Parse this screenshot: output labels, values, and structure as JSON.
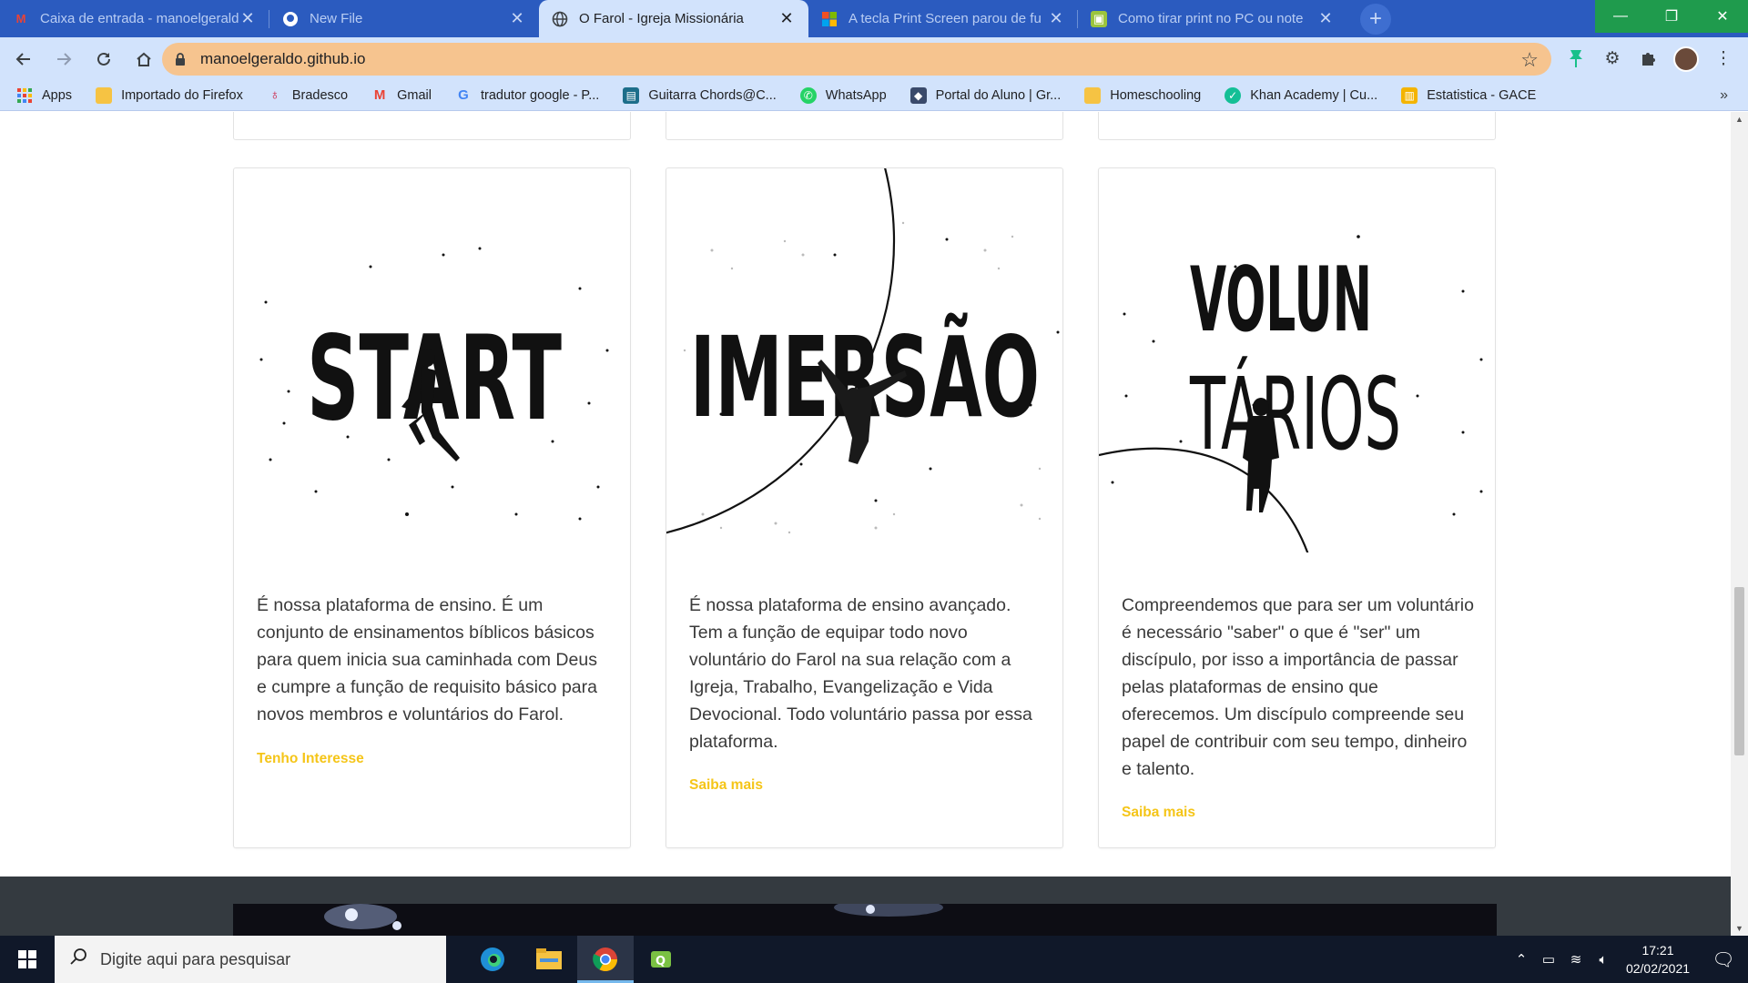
{
  "browser": {
    "tabs": [
      {
        "label": "Caixa de entrada - manoelgeraldo",
        "icon": "gmail-icon",
        "active": false
      },
      {
        "label": "New File",
        "icon": "github-icon",
        "active": false
      },
      {
        "label": "O Farol - Igreja Missionária",
        "icon": "globe-icon",
        "active": true
      },
      {
        "label": "A tecla Print Screen parou de fu",
        "icon": "microsoft-icon",
        "active": false
      },
      {
        "label": "Como tirar print no PC ou note",
        "icon": "site-icon",
        "active": false
      }
    ],
    "url": "manoelgeraldo.github.io",
    "bookmarks": [
      {
        "label": "Apps",
        "icon": "apps-grid-icon",
        "color": "#ea4335"
      },
      {
        "label": "Importado do Firefox",
        "icon": "folder-icon",
        "color": "#f6c343"
      },
      {
        "label": "Bradesco",
        "icon": "bradesco-icon",
        "color": "#cc092f"
      },
      {
        "label": "Gmail",
        "icon": "gmail-icon",
        "color": "#ea4335"
      },
      {
        "label": "tradutor google - P...",
        "icon": "google-icon",
        "color": "#4285f4"
      },
      {
        "label": "Guitarra Chords@C...",
        "icon": "guitar-icon",
        "color": "#1d6e8a"
      },
      {
        "label": "WhatsApp",
        "icon": "whatsapp-icon",
        "color": "#25d366"
      },
      {
        "label": "Portal do Aluno | Gr...",
        "icon": "portal-icon",
        "color": "#3a4a6b"
      },
      {
        "label": "Homeschooling",
        "icon": "folder-icon",
        "color": "#f6c343"
      },
      {
        "label": "Khan Academy | Cu...",
        "icon": "khan-icon",
        "color": "#14bf96"
      },
      {
        "label": "Estatistica - GACE",
        "icon": "sheets-icon",
        "color": "#f4b400"
      }
    ]
  },
  "cards": [
    {
      "art_words": [
        "START"
      ],
      "description": "É nossa plataforma de ensino. É um conjunto de ensinamentos bíblicos básicos para quem inicia sua caminhada com Deus e cumpre a função de requisito básico para novos membros e voluntários do Farol.",
      "cta": "Tenho Interesse"
    },
    {
      "art_words": [
        "IMERSÃO"
      ],
      "description": "É nossa plataforma de ensino avançado. Tem a função de equipar todo novo voluntário do Farol na sua relação com a Igreja, Trabalho, Evangelização e Vida Devocional. Todo voluntário passa por essa plataforma.",
      "cta": "Saiba mais"
    },
    {
      "art_words": [
        "VOLUN",
        "TÁRIOS"
      ],
      "description": "Compreendemos que para ser um voluntário é necessário \"saber\" o que é \"ser\" um discípulo, por isso a importância de passar pelas plataformas de ensino que oferecemos. Um discípulo compreende seu papel de contribuir com seu tempo, dinheiro e talento.",
      "cta": "Saiba mais"
    }
  ],
  "taskbar": {
    "search_placeholder": "Digite aqui para pesquisar",
    "time": "17:21",
    "date": "02/02/2021"
  },
  "colors": {
    "accent": "#f5c518",
    "tabstrip": "#2b5bbf",
    "toolbar": "#d2e3fc",
    "omnibox": "#f6c48f"
  }
}
